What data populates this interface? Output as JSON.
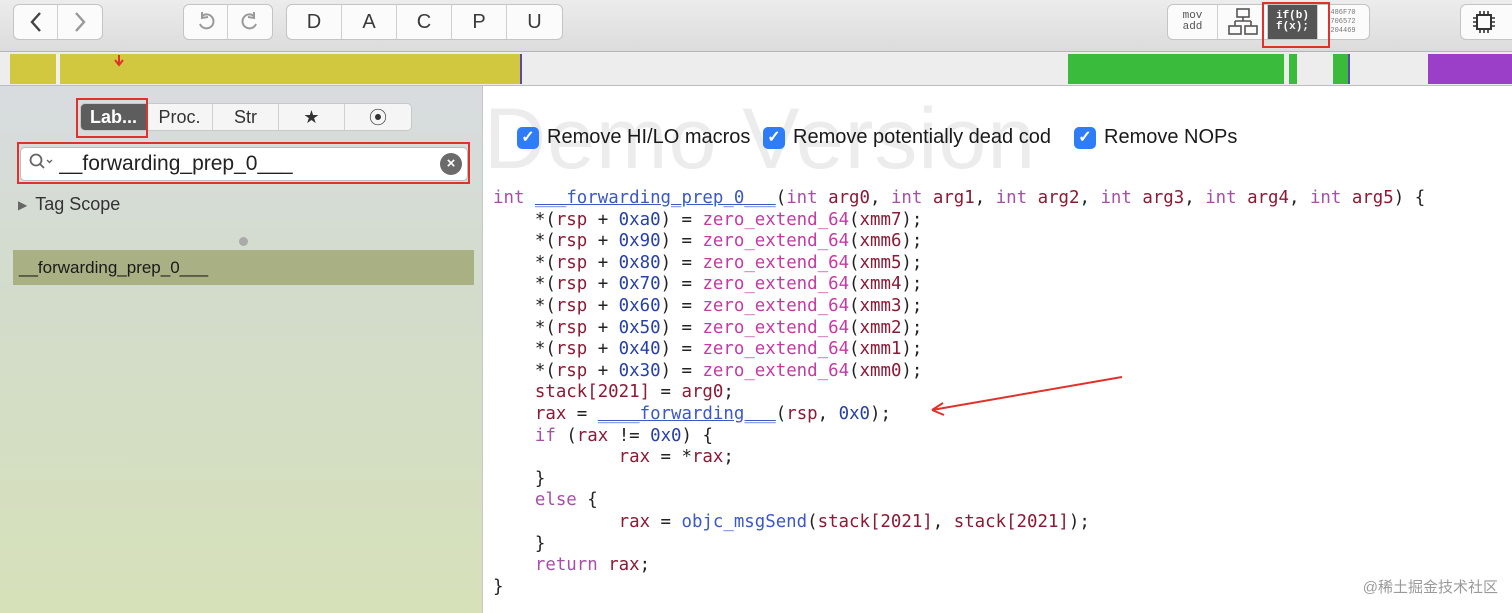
{
  "toolbar": {
    "back_icon": "chevron-left-icon",
    "forward_icon": "chevron-right-icon",
    "undo_icon": "undo-icon",
    "redo_icon": "redo-icon",
    "letters": [
      "D",
      "A",
      "C",
      "P",
      "U"
    ],
    "view_asm": [
      "mov",
      "add"
    ],
    "view_pseudo": [
      "if(b)",
      "f(x);"
    ],
    "view_hex": [
      "486F70",
      "706572",
      "204469"
    ],
    "chip_icon": "chip-icon"
  },
  "sidebar": {
    "tabs": [
      "Lab...",
      "Proc.",
      "Str",
      "★",
      "⦿"
    ],
    "search_value": "__forwarding_prep_0___",
    "scope_label": "Tag Scope",
    "result": "__forwarding_prep_0___"
  },
  "main": {
    "watermark": "Demo Version",
    "options": [
      "Remove HI/LO macros",
      "Remove potentially dead cod",
      "Remove NOPs"
    ]
  },
  "footer": "@稀土掘金技术社区",
  "colors": {
    "accent": "#2f7df6",
    "highlight": "#e0312d",
    "nav_yellow": "#d2c840",
    "nav_green": "#3bbb3b",
    "nav_purple": "#9b3fc8"
  }
}
